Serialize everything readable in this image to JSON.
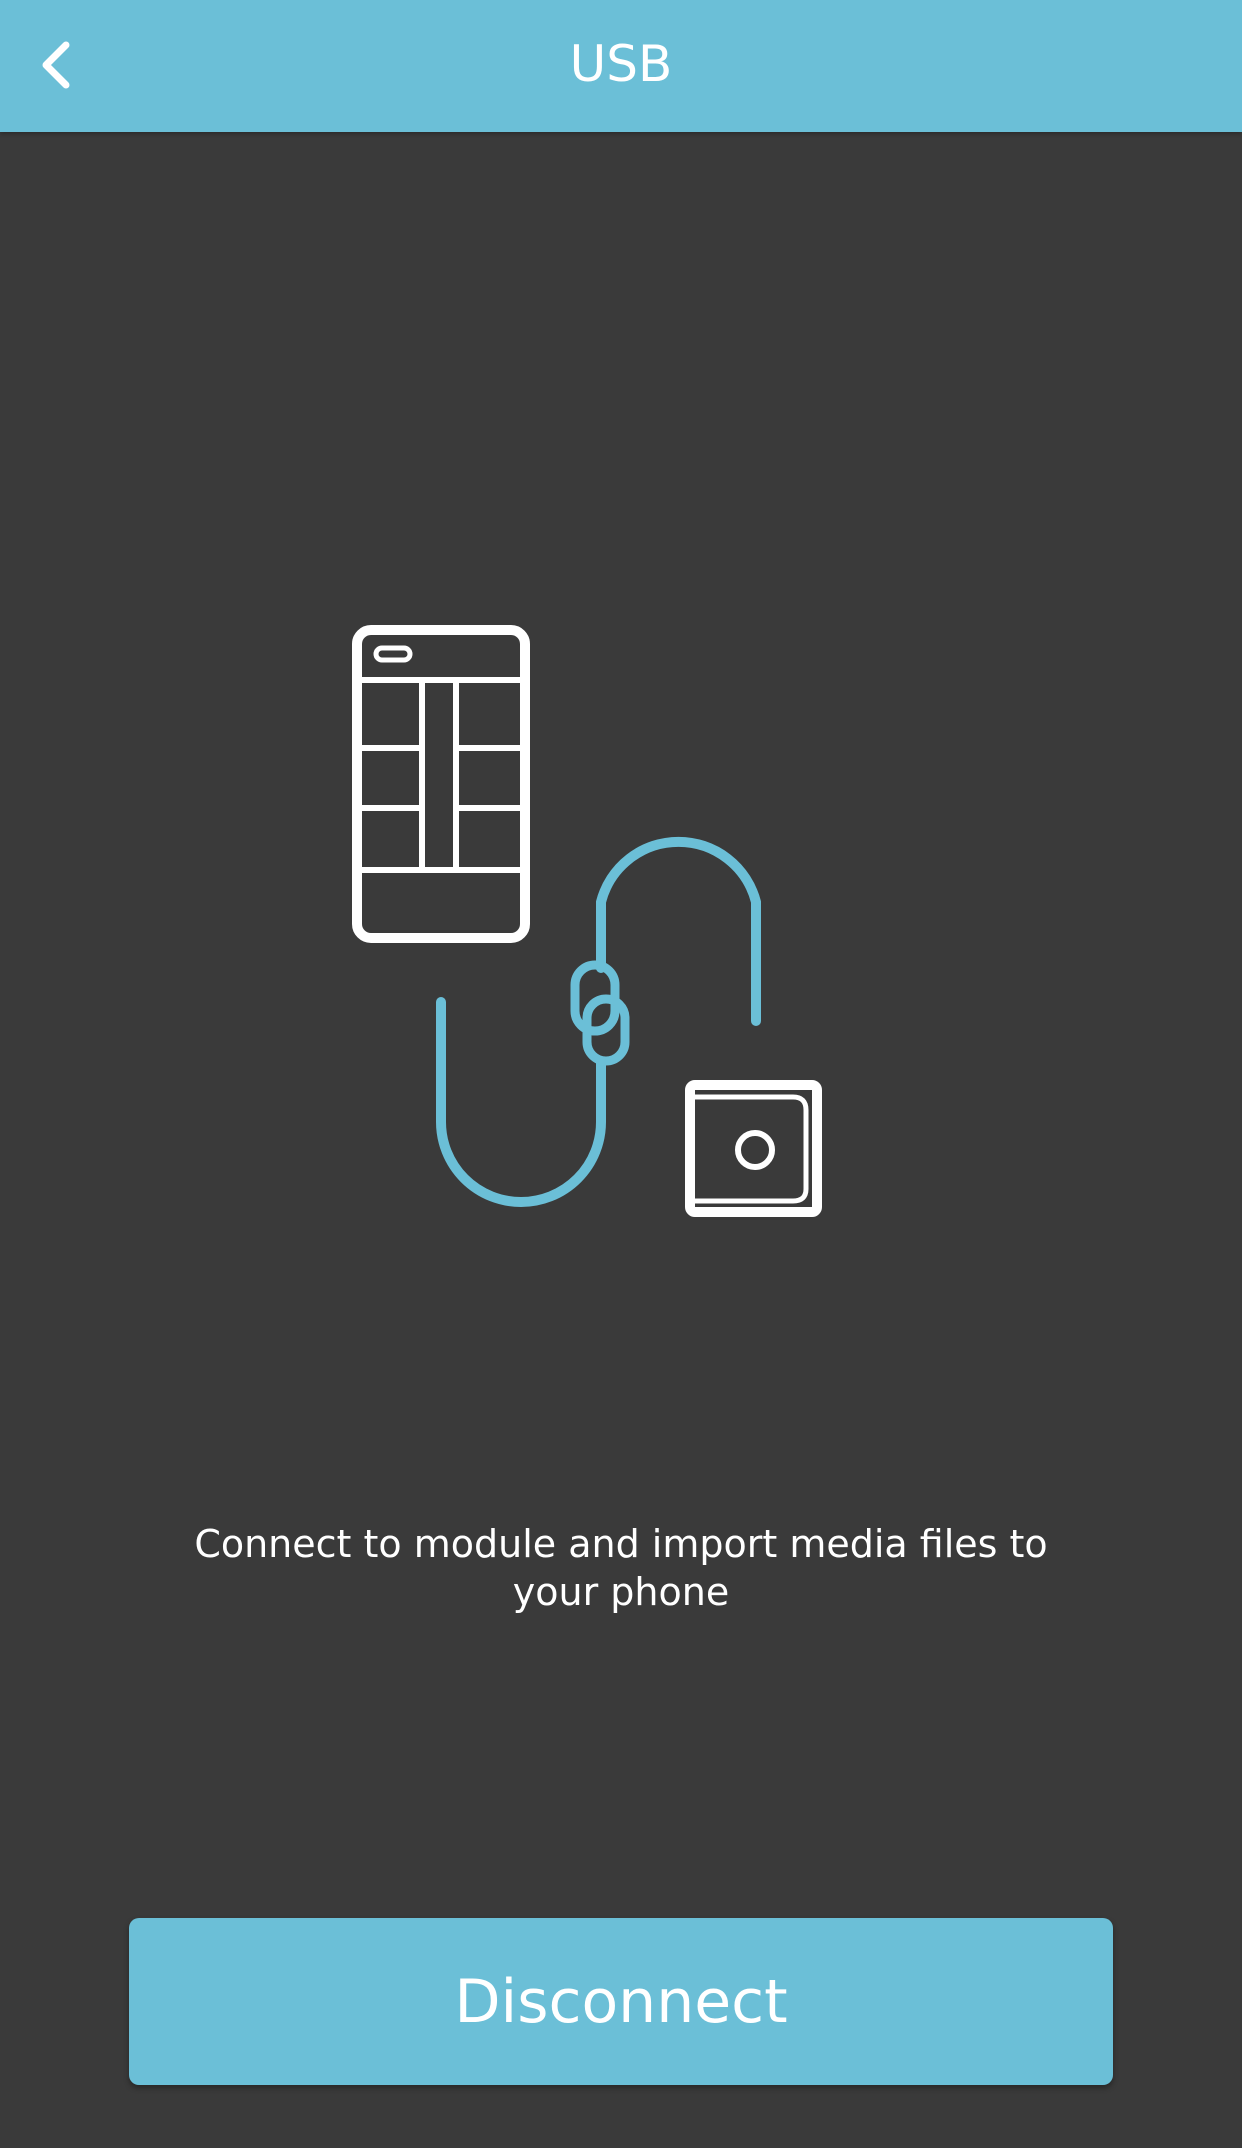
{
  "header": {
    "title": "USB",
    "back_icon": "chevron-left-icon"
  },
  "illustration": {
    "icons": [
      "phone-icon",
      "cable-icon",
      "chain-link-icon",
      "module-icon"
    ],
    "accent_color": "#6bbfd7"
  },
  "main": {
    "description": "Connect to module and import media files to your phone"
  },
  "footer": {
    "disconnect_label": "Disconnect"
  },
  "colors": {
    "accent": "#6bbfd7",
    "background": "#3a3a3a",
    "text": "#ffffff"
  }
}
